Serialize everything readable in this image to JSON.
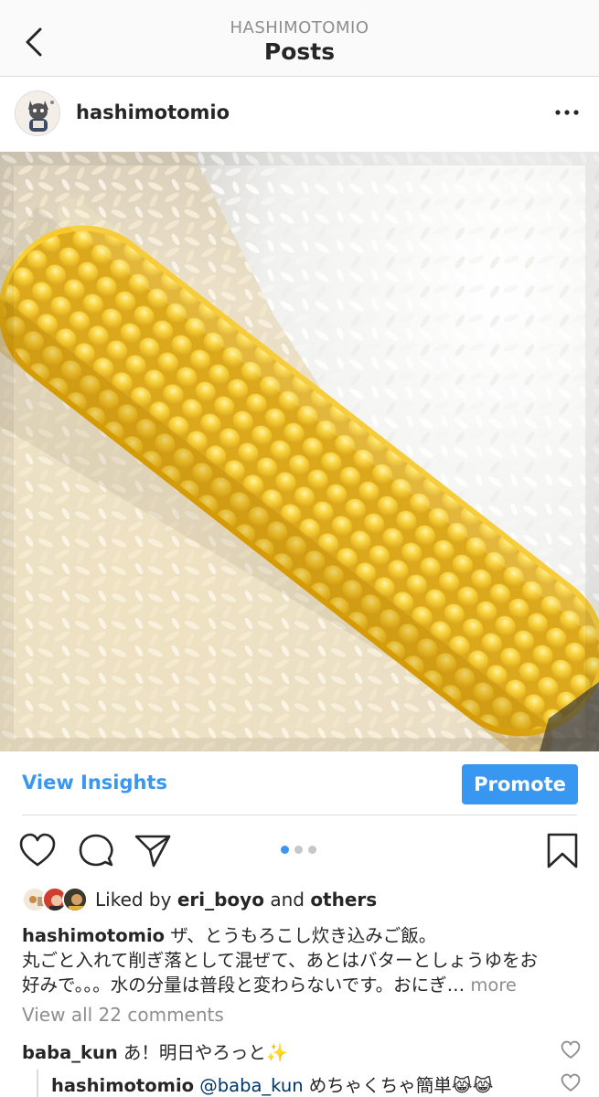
{
  "header": {
    "account": "HASHIMOTOMIO",
    "title": "Posts"
  },
  "post": {
    "username": "hashimotomio",
    "insights_label": "View Insights",
    "promote_label": "Promote",
    "carousel": {
      "count": 3,
      "current": 1
    },
    "likes": {
      "prefix": "Liked by",
      "user": "eri_boyo",
      "connector": "and",
      "others": "others"
    },
    "caption": {
      "username": "hashimotomio",
      "line1": "ザ、とうもろこし炊き込みご飯。",
      "line2": "丸ごと入れて削ぎ落として混ぜて、あとはバターとしょうゆをお",
      "line3": "好みで。。。水の分量は普段と変わらないです。おにぎ…",
      "more": "more"
    },
    "view_comments": "View all 22 comments",
    "comments": [
      {
        "username": "baba_kun",
        "text": "あ！明日やろっと✨"
      },
      {
        "username": "hashimotomio",
        "mention": "@baba_kun",
        "text": "めちゃくちゃ簡単😹😹"
      }
    ]
  },
  "colors": {
    "accent": "#3897f0",
    "muted": "#8e8e8e",
    "text": "#262626",
    "border": "#dbdbdb"
  },
  "icons": [
    "chevron-left-icon",
    "more-horizontal-icon",
    "heart-icon",
    "comment-icon",
    "share-icon",
    "bookmark-icon"
  ]
}
